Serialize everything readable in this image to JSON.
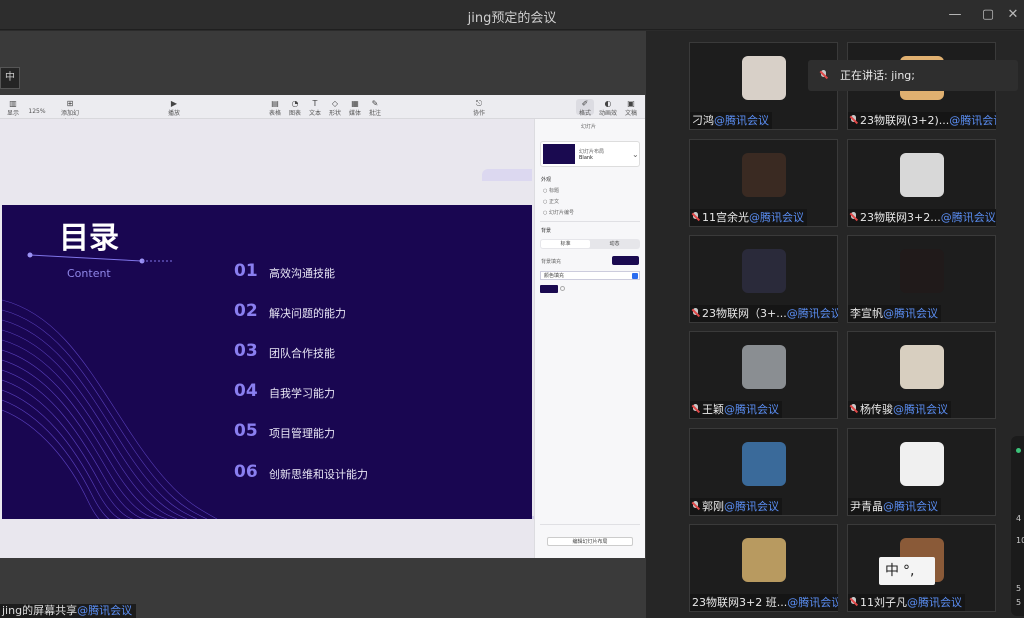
{
  "window": {
    "title": "jing预定的会议",
    "controls": {
      "minimize": "—",
      "maximize": "▢",
      "close": "✕"
    }
  },
  "share_label": "中",
  "presentation": {
    "toolbar": [
      {
        "glyph": "▥",
        "label": "显示"
      },
      {
        "glyph": "",
        "label": "125%"
      },
      {
        "glyph": "⊞",
        "label": "添加幻灯片"
      },
      {
        "glyph": "▶",
        "label": "播放"
      },
      {
        "glyph": "▤",
        "label": "表格"
      },
      {
        "glyph": "◔",
        "label": "图表"
      },
      {
        "glyph": "T",
        "label": "文本"
      },
      {
        "glyph": "◇",
        "label": "形状"
      },
      {
        "glyph": "▦",
        "label": "媒体"
      },
      {
        "glyph": "✎",
        "label": "批注"
      },
      {
        "glyph": "⎋",
        "label": "协作"
      },
      {
        "glyph": "✐",
        "label": "格式"
      },
      {
        "glyph": "◐",
        "label": "动画效果"
      },
      {
        "glyph": "▣",
        "label": "文稿"
      }
    ],
    "slide": {
      "title": "目录",
      "subtitle": "Content",
      "items": [
        {
          "num": "01",
          "text": "高效沟通技能"
        },
        {
          "num": "02",
          "text": "解决问题的能力"
        },
        {
          "num": "03",
          "text": "团队合作技能"
        },
        {
          "num": "04",
          "text": "自我学习能力"
        },
        {
          "num": "05",
          "text": "项目管理能力"
        },
        {
          "num": "06",
          "text": "创新思维和设计能力"
        }
      ]
    },
    "panel": {
      "header": "幻灯片",
      "layout_name": "Blank",
      "layout_label": "幻灯片布局",
      "appearance_label": "外观",
      "checks": [
        "标题",
        "正文",
        "幻灯片编号"
      ],
      "background_label": "背景",
      "seg_on": "标准",
      "seg_off": "动态",
      "fill_label": "背景填充",
      "fill_option": "颜色填充",
      "button": "编辑幻灯片布局"
    }
  },
  "presenter": {
    "name": "jing的屏幕共享",
    "tag": "@腾讯会议"
  },
  "speaking": {
    "prefix": "正在讲话:",
    "name": "jing;"
  },
  "participants": [
    {
      "name": "刁鸿",
      "tag": "@腾讯会议",
      "muted": false,
      "avatar_color": "#d8d0c8"
    },
    {
      "name": "23物联网(3+2)...",
      "tag": "@腾讯会议",
      "muted": true,
      "avatar_color": "#e0b070"
    },
    {
      "name": "11宫余光",
      "tag": "@腾讯会议",
      "muted": true,
      "avatar_color": "#3a2a22"
    },
    {
      "name": "23物联网3+2...",
      "tag": "@腾讯会议",
      "muted": true,
      "avatar_color": "#d8d8d8"
    },
    {
      "name": "23物联网（3+...",
      "tag": "@腾讯会议",
      "muted": true,
      "avatar_color": "#2a2a3a"
    },
    {
      "name": "李宣帆",
      "tag": "@腾讯会议",
      "muted": false,
      "avatar_color": "#201a1a"
    },
    {
      "name": "王颖",
      "tag": "@腾讯会议",
      "muted": true,
      "avatar_color": "#8a8e92"
    },
    {
      "name": "杨传骏",
      "tag": "@腾讯会议",
      "muted": true,
      "avatar_color": "#d8cfc0"
    },
    {
      "name": "郭刚",
      "tag": "@腾讯会议",
      "muted": true,
      "avatar_color": "#3a6a9a"
    },
    {
      "name": "尹青晶",
      "tag": "@腾讯会议",
      "muted": false,
      "avatar_color": "#f0f0f0"
    },
    {
      "name": "23物联网3+2 班...",
      "tag": "@腾讯会议",
      "muted": false,
      "avatar_color": "#b89a60"
    },
    {
      "name": "11刘子凡",
      "tag": "@腾讯会议",
      "muted": true,
      "avatar_color": "#8a5a38"
    }
  ],
  "ime": {
    "char": "中",
    "mode": "°,"
  },
  "edge": [
    "4",
    "10",
    "5",
    "5"
  ]
}
